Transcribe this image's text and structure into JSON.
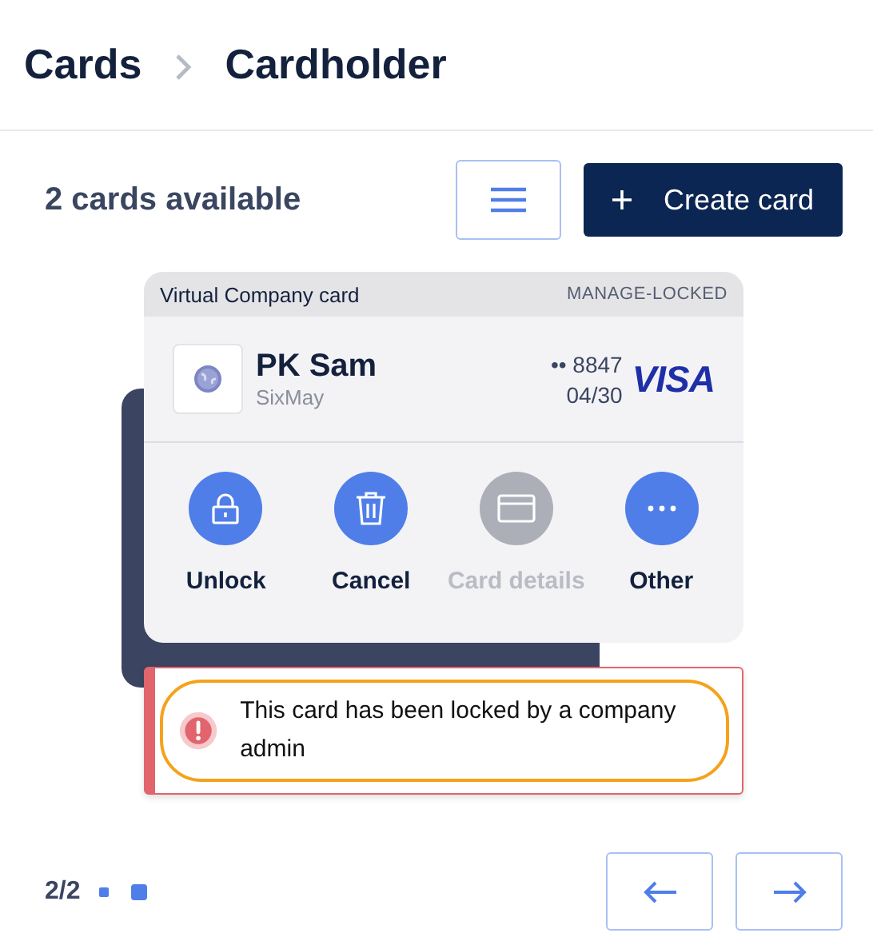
{
  "breadcrumb": [
    "Cards",
    "Cardholder"
  ],
  "toolbar": {
    "count": "2 cards available",
    "create_button": "Create card"
  },
  "card": {
    "type": "Virtual Company card",
    "status": "MANAGE-LOCKED",
    "holder": "PK Sam",
    "company": "SixMay",
    "number": "•• 8847",
    "expiry": "04/30",
    "network": "VISA",
    "actions": [
      {
        "kind": "lock",
        "label": "Unlock",
        "disabled": false
      },
      {
        "kind": "trash",
        "label": "Cancel",
        "disabled": false
      },
      {
        "kind": "card",
        "label": "Card details",
        "disabled": true
      },
      {
        "kind": "more",
        "label": "Other",
        "disabled": false
      }
    ]
  },
  "alert": {
    "message": "This card has been locked by a company admin"
  },
  "pager": {
    "position": "2/2",
    "dots": [
      {
        "selected": false
      },
      {
        "selected": true
      }
    ]
  }
}
